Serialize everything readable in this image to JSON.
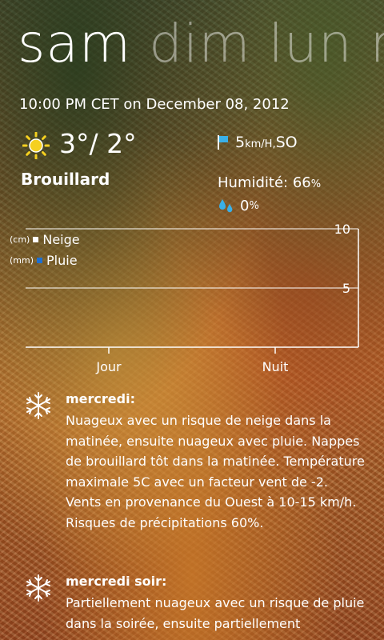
{
  "pivot": {
    "items": [
      "sam",
      "dim",
      "lun",
      "m"
    ]
  },
  "timestamp": "10:00 PM CET on December 08, 2012",
  "current": {
    "temps": "3°/ 2°",
    "condition": "Brouillard",
    "icon": "sun-icon",
    "wind_value": "5",
    "wind_unit": "km/H,",
    "wind_dir": " SO",
    "humidity_label": "Humidité: 66",
    "humidity_unit": "%",
    "precip_value": "0",
    "precip_unit": "%"
  },
  "chart_data": {
    "type": "bar",
    "categories": [
      "Jour",
      "Nuit"
    ],
    "series": [
      {
        "name": "Neige",
        "unit": "(cm)",
        "values": [
          0,
          0
        ],
        "color": "#ffffff"
      },
      {
        "name": "Pluie",
        "unit": "(mm)",
        "values": [
          0,
          0
        ],
        "color": "#1e6fd0"
      }
    ],
    "ylim": [
      0,
      10
    ],
    "yticks": [
      "10",
      "5"
    ],
    "grid": true,
    "legend": "top-left"
  },
  "forecast": [
    {
      "icon": "snowflake-icon",
      "title": "mercredi:",
      "text": "Nuageux avec un risque de neige dans la matinée, ensuite nuageux avec pluie. Nappes de brouillard tôt dans la matinée. Température maximale 5C avec un facteur vent de -2. Vents en provenance du Ouest à 10-15 km/h. Risques de précipitations 60%."
    },
    {
      "icon": "snowflake-icon",
      "title": "mercredi soir:",
      "text": "Partiellement nuageux avec un risque de pluie dans la soirée, ensuite partiellement"
    }
  ]
}
